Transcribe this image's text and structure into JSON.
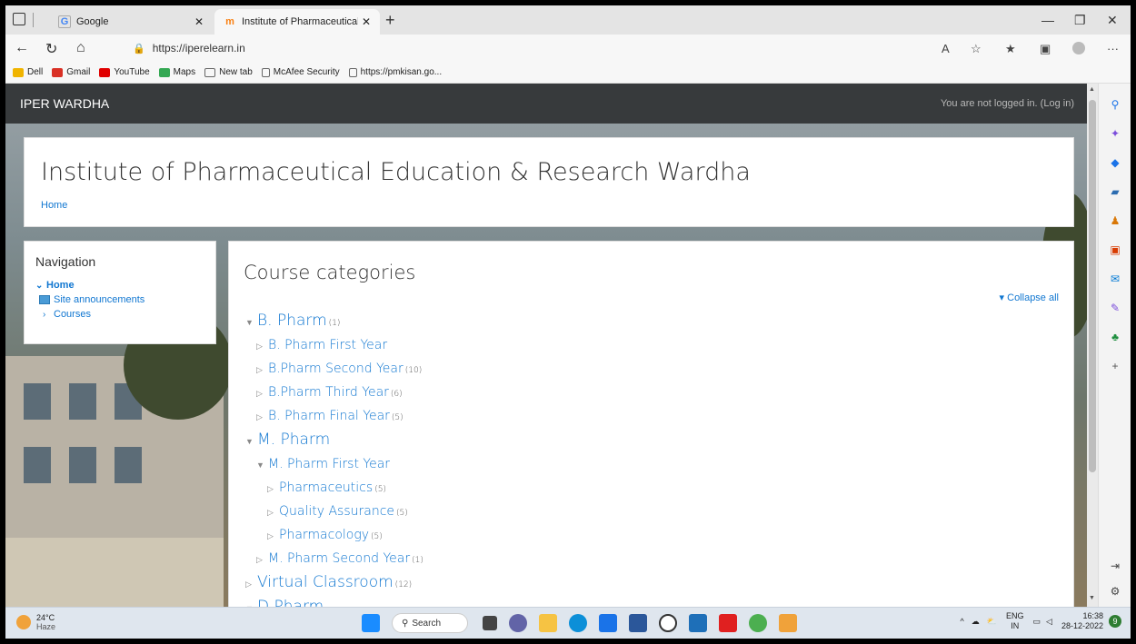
{
  "browser": {
    "tabs": [
      {
        "label": "Google",
        "favicon": "G",
        "active": false
      },
      {
        "label": "Institute of Pharmaceutical Educa",
        "favicon": "m",
        "active": true
      }
    ],
    "url": "https://iperelearn.in",
    "url_host": "iperelearn.in",
    "bookmarks": [
      {
        "label": "Dell",
        "icon": "folder-icon",
        "color": "#f0b400"
      },
      {
        "label": "Gmail",
        "icon": "gmail-icon",
        "color": "#d93025"
      },
      {
        "label": "YouTube",
        "icon": "youtube-icon",
        "color": "#e00000"
      },
      {
        "label": "Maps",
        "icon": "maps-icon",
        "color": "#34a853"
      },
      {
        "label": "New tab",
        "icon": "newtab-icon",
        "color": "#666666"
      },
      {
        "label": "McAfee Security",
        "icon": "page-icon",
        "color": "#666666"
      },
      {
        "label": "https://pmkisan.go...",
        "icon": "page-icon",
        "color": "#666666"
      }
    ]
  },
  "site": {
    "name": "IPER WARDHA",
    "login_text": "You are not logged in. (",
    "login_link": "Log in",
    "login_close": ")",
    "title": "Institute of Pharmaceutical Education & Research Wardha",
    "breadcrumb": "Home"
  },
  "navigation": {
    "title": "Navigation",
    "home": "Home",
    "site_announcements": "Site announcements",
    "courses": "Courses"
  },
  "main": {
    "title": "Course categories",
    "collapse_all": "Collapse all",
    "categories": [
      {
        "name": "B. Pharm",
        "count": "(1)",
        "expanded": true
      },
      {
        "name": "B. Pharm First Year",
        "count": ""
      },
      {
        "name": "B.Pharm Second Year",
        "count": "(10)"
      },
      {
        "name": "B.Pharm Third Year",
        "count": "(6)"
      },
      {
        "name": "B. Pharm Final Year",
        "count": "(5)"
      },
      {
        "name": "M. Pharm",
        "count": "",
        "expanded": true
      },
      {
        "name": "M. Pharm First Year",
        "count": "",
        "expanded": true
      },
      {
        "name": "Pharmaceutics",
        "count": "(5)"
      },
      {
        "name": "Quality Assurance",
        "count": "(5)"
      },
      {
        "name": "Pharmacology",
        "count": "(5)"
      },
      {
        "name": "M. Pharm Second Year",
        "count": "(1)"
      },
      {
        "name": "Virtual Classroom",
        "count": "(12)"
      },
      {
        "name": "D.Pharm",
        "count": "",
        "expanded": true
      }
    ]
  },
  "taskbar": {
    "temp": "24°C",
    "weather": "Haze",
    "search": "Search",
    "lang_top": "ENG",
    "lang_bottom": "IN",
    "time": "16:38",
    "date": "28-12-2022",
    "badge": "9"
  },
  "colors": {
    "link": "#1177d1",
    "sitebar": "#373a3c"
  }
}
